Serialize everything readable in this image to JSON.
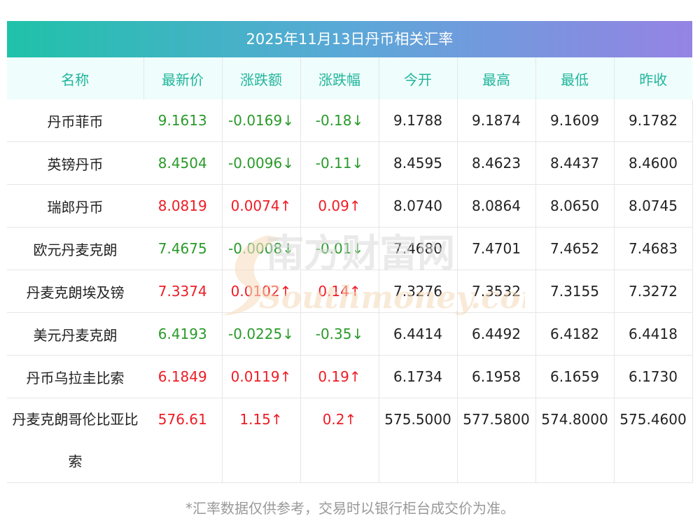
{
  "title": "2025年11月13日丹币相关汇率",
  "headers": [
    "名称",
    "最新价",
    "涨跌额",
    "涨跌幅",
    "今开",
    "最高",
    "最低",
    "昨收"
  ],
  "rows": [
    {
      "name": "丹币菲币",
      "latest": "9.1613",
      "change": "-0.0169↓",
      "change_pct": "-0.18↓",
      "open": "9.1788",
      "high": "9.1874",
      "low": "9.1609",
      "prev_close": "9.1782",
      "trend": "down"
    },
    {
      "name": "英镑丹币",
      "latest": "8.4504",
      "change": "-0.0096↓",
      "change_pct": "-0.11↓",
      "open": "8.4595",
      "high": "8.4623",
      "low": "8.4437",
      "prev_close": "8.4600",
      "trend": "down"
    },
    {
      "name": "瑞郎丹币",
      "latest": "8.0819",
      "change": "0.0074↑",
      "change_pct": "0.09↑",
      "open": "8.0740",
      "high": "8.0864",
      "low": "8.0650",
      "prev_close": "8.0745",
      "trend": "up"
    },
    {
      "name": "欧元丹麦克朗",
      "latest": "7.4675",
      "change": "-0.0008↓",
      "change_pct": "-0.01↓",
      "open": "7.4680",
      "high": "7.4701",
      "low": "7.4652",
      "prev_close": "7.4683",
      "trend": "down"
    },
    {
      "name": "丹麦克朗埃及镑",
      "latest": "7.3374",
      "change": "0.0102↑",
      "change_pct": "0.14↑",
      "open": "7.3276",
      "high": "7.3532",
      "low": "7.3155",
      "prev_close": "7.3272",
      "trend": "up"
    },
    {
      "name": "美元丹麦克朗",
      "latest": "6.4193",
      "change": "-0.0225↓",
      "change_pct": "-0.35↓",
      "open": "6.4414",
      "high": "6.4492",
      "low": "6.4182",
      "prev_close": "6.4418",
      "trend": "down"
    },
    {
      "name": "丹币乌拉圭比索",
      "latest": "6.1849",
      "change": "0.0119↑",
      "change_pct": "0.19↑",
      "open": "6.1734",
      "high": "6.1958",
      "low": "6.1659",
      "prev_close": "6.1730",
      "trend": "up"
    },
    {
      "name": "丹麦克朗哥伦比亚比索",
      "latest": "576.61",
      "change": "1.15↑",
      "change_pct": "0.2↑",
      "open": "575.5000",
      "high": "577.5800",
      "low": "574.8000",
      "prev_close": "575.4600",
      "trend": "up"
    }
  ],
  "footnote": "*汇率数据仅供参考，交易时以银行柜台成交价为准。",
  "watermark": {
    "cn": "南方财富网",
    "en": "Southmoney.com"
  },
  "colors": {
    "up": "#ee1c25",
    "down": "#2a9a2a",
    "header_text": "#21b59b",
    "header_bg": "#effdfc"
  }
}
